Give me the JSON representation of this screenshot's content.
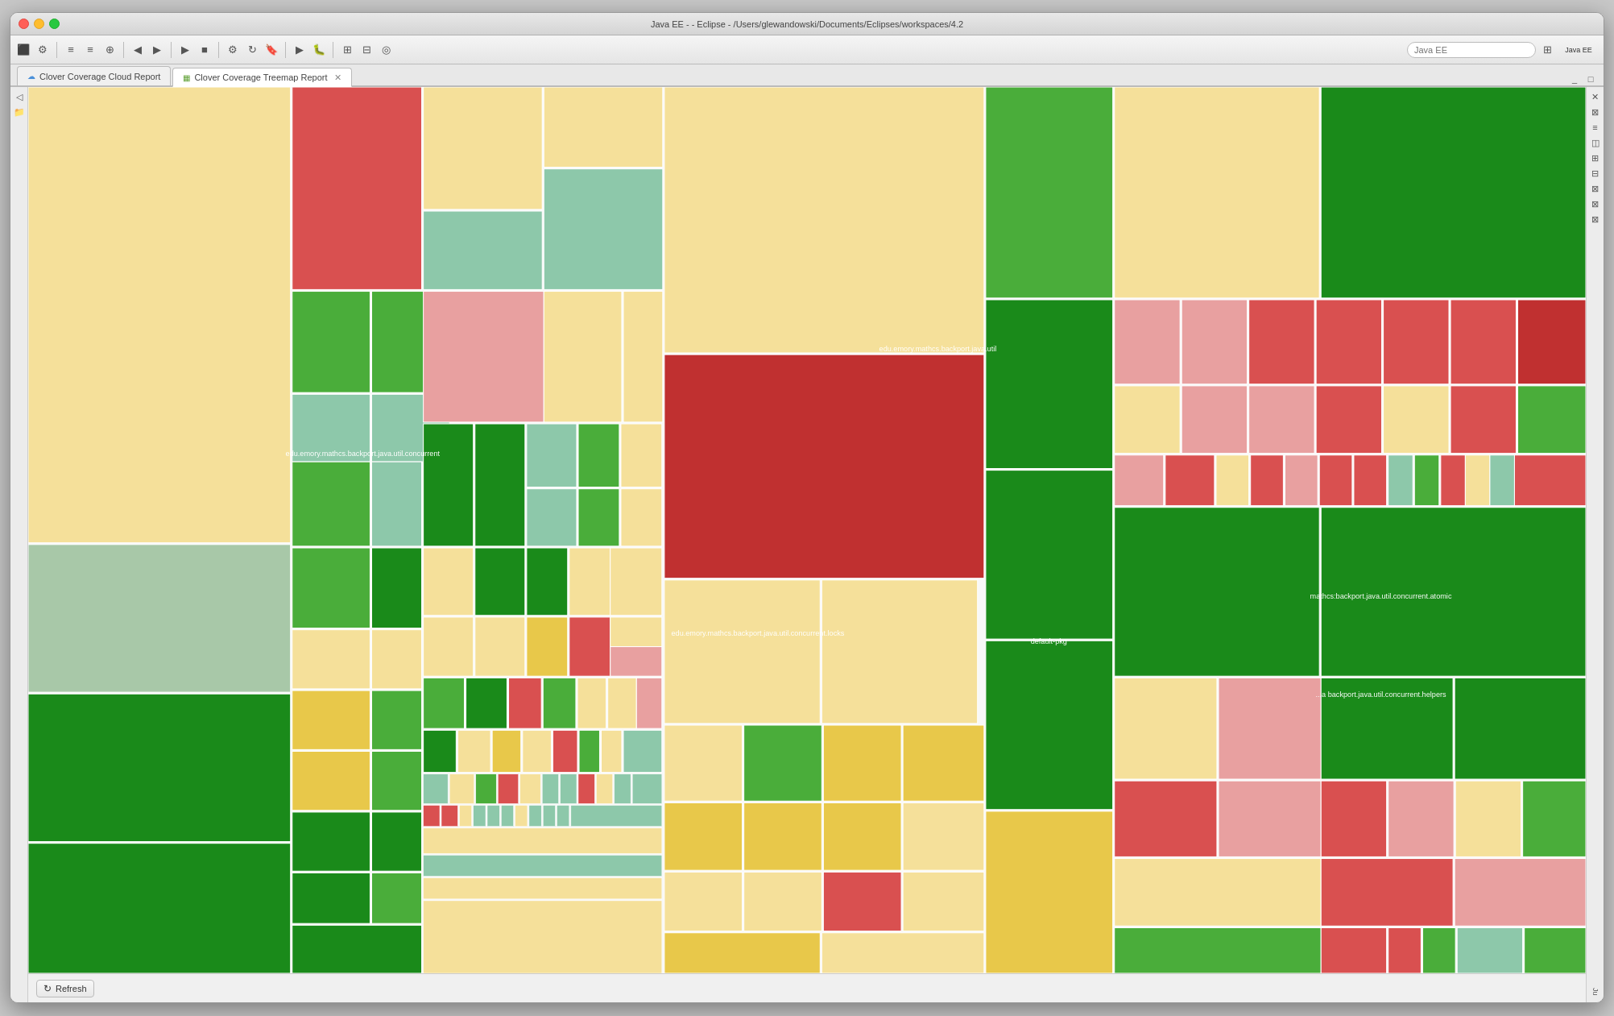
{
  "window": {
    "title": "Java EE - - Eclipse - /Users/glewandowski/Documents/Eclipses/workspaces/4.2",
    "buttons": {
      "close": "close",
      "minimize": "minimize",
      "maximize": "maximize"
    }
  },
  "tabs": [
    {
      "id": "cloud",
      "label": "Clover Coverage Cloud Report",
      "icon": "cloud",
      "active": false
    },
    {
      "id": "treemap",
      "label": "Clover Coverage Treemap Report",
      "icon": "treemap",
      "active": true,
      "closable": true
    }
  ],
  "toolbar": {
    "search_placeholder": "Java EE"
  },
  "treemap": {
    "labels": [
      "edu.emory.mathcs.backport.java.util.concurrent",
      "edu.emory.mathcs.backport.java.util",
      "edu.emory.mathcs.backport.java.util.concurrent.locks",
      "default-pkg",
      "mathcs:backport.java.util.concurrent.atomic",
      "...a backport.java.util.concurrent.helpers"
    ]
  },
  "bottom": {
    "refresh_label": "Refresh"
  },
  "colors": {
    "light_yellow": "#f5e09a",
    "medium_yellow": "#e8c84a",
    "light_green": "#8dc87a",
    "medium_green": "#4aad3a",
    "dark_green": "#1a8a1a",
    "light_red": "#e89090",
    "medium_red": "#d95050",
    "dark_red": "#c03030",
    "light_sage": "#a8c8a8",
    "medium_sage": "#7aaa7a"
  }
}
